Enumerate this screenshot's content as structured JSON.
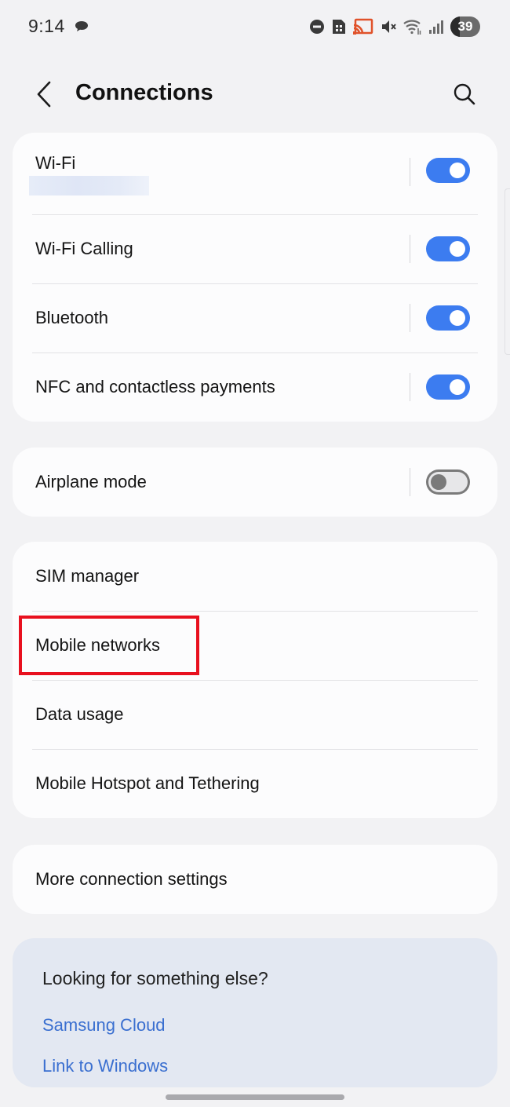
{
  "status_bar": {
    "time": "9:14",
    "battery_level": "39",
    "icons": [
      "chat-bubble-icon",
      "do-not-disturb-icon",
      "sim-icon",
      "cast-icon",
      "mute-icon",
      "wifi-icon",
      "signal-icon",
      "battery-icon"
    ]
  },
  "header": {
    "title": "Connections"
  },
  "connectivity": {
    "wifi": {
      "label": "Wi-Fi",
      "enabled": true
    },
    "wifi_calling": {
      "label": "Wi-Fi Calling",
      "enabled": true
    },
    "bluetooth": {
      "label": "Bluetooth",
      "enabled": true
    },
    "nfc": {
      "label": "NFC and contactless payments",
      "enabled": true
    }
  },
  "airplane": {
    "label": "Airplane mode",
    "enabled": false
  },
  "network_items": [
    {
      "label": "SIM manager"
    },
    {
      "label": "Mobile networks"
    },
    {
      "label": "Data usage"
    },
    {
      "label": "Mobile Hotspot and Tethering"
    }
  ],
  "more": {
    "label": "More connection settings"
  },
  "suggestions": {
    "title": "Looking for something else?",
    "links": [
      {
        "label": "Samsung Cloud"
      },
      {
        "label": "Link to Windows"
      }
    ]
  },
  "colors": {
    "accent": "#3c7cf0",
    "link": "#3a6fd0",
    "highlight": "#e8101e",
    "background": "#f2f2f4",
    "card": "#fcfcfd",
    "suggest_card": "#e3e8f2"
  }
}
